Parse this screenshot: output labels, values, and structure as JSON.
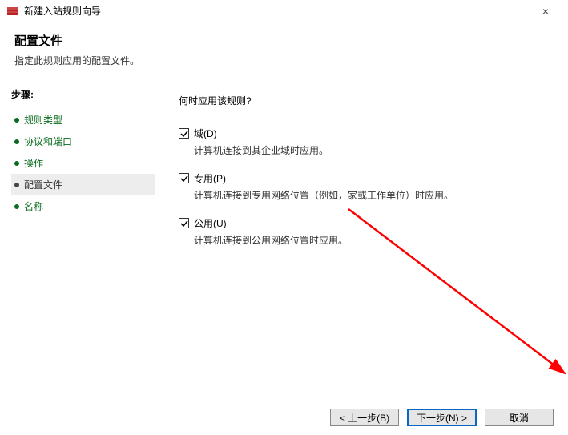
{
  "window": {
    "title": "新建入站规则向导",
    "close_symbol": "×"
  },
  "header": {
    "title": "配置文件",
    "subtitle": "指定此规则应用的配置文件。"
  },
  "sidebar": {
    "steps_label": "步骤:",
    "items": [
      {
        "label": "规则类型"
      },
      {
        "label": "协议和端口"
      },
      {
        "label": "操作"
      },
      {
        "label": "配置文件"
      },
      {
        "label": "名称"
      }
    ],
    "active_index": 3
  },
  "content": {
    "question": "何时应用该规则?",
    "checkboxes": [
      {
        "label": "域(D)",
        "checked": true,
        "desc": "计算机连接到其企业域时应用。"
      },
      {
        "label": "专用(P)",
        "checked": true,
        "desc": "计算机连接到专用网络位置（例如，家或工作单位）时应用。"
      },
      {
        "label": "公用(U)",
        "checked": true,
        "desc": "计算机连接到公用网络位置时应用。"
      }
    ]
  },
  "footer": {
    "back": "< 上一步(B)",
    "next": "下一步(N) >",
    "cancel": "取消"
  },
  "annotation": {
    "arrow_color": "#ff0000"
  }
}
